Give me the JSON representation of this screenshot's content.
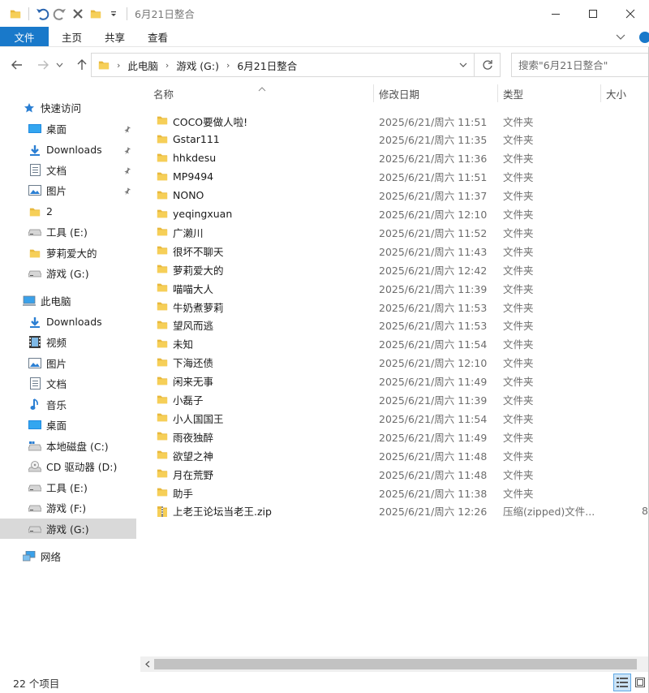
{
  "window": {
    "title": "6月21日整合",
    "minimize_icon": "minimize-icon",
    "maximize_icon": "maximize-icon",
    "close_icon": "close-icon"
  },
  "ribbon": {
    "tabs": [
      {
        "label": "文件"
      },
      {
        "label": "主页"
      },
      {
        "label": "共享"
      },
      {
        "label": "查看"
      }
    ]
  },
  "address": {
    "crumbs": [
      "此电脑",
      "游戏 (G:)",
      "6月21日整合"
    ]
  },
  "search": {
    "placeholder": "搜索\"6月21日整合\""
  },
  "columns": {
    "name": "名称",
    "date": "修改日期",
    "type": "类型",
    "size": "大小"
  },
  "navpane": {
    "quick_access": "快速访问",
    "quick_items": [
      {
        "label": "桌面",
        "icon": "desktop-icon",
        "pinned": true
      },
      {
        "label": "Downloads",
        "icon": "download-icon",
        "pinned": true
      },
      {
        "label": "文档",
        "icon": "document-icon",
        "pinned": true
      },
      {
        "label": "图片",
        "icon": "picture-icon",
        "pinned": true
      },
      {
        "label": "2",
        "icon": "folder-icon",
        "pinned": false
      },
      {
        "label": "工具 (E:)",
        "icon": "drive-icon",
        "pinned": false
      },
      {
        "label": "萝莉爱大的",
        "icon": "folder-icon",
        "pinned": false
      },
      {
        "label": "游戏 (G:)",
        "icon": "drive-icon",
        "pinned": false
      }
    ],
    "this_pc": "此电脑",
    "pc_items": [
      {
        "label": "Downloads",
        "icon": "download-icon"
      },
      {
        "label": "视频",
        "icon": "video-icon"
      },
      {
        "label": "图片",
        "icon": "picture-icon"
      },
      {
        "label": "文档",
        "icon": "document-icon"
      },
      {
        "label": "音乐",
        "icon": "music-icon"
      },
      {
        "label": "桌面",
        "icon": "desktop-icon"
      },
      {
        "label": "本地磁盘 (C:)",
        "icon": "system-drive-icon"
      },
      {
        "label": "CD 驱动器 (D:)",
        "icon": "cd-drive-icon"
      },
      {
        "label": "工具 (E:)",
        "icon": "drive-icon"
      },
      {
        "label": "游戏 (F:)",
        "icon": "drive-icon"
      },
      {
        "label": "游戏 (G:)",
        "icon": "drive-icon"
      }
    ],
    "network": "网络"
  },
  "files": [
    {
      "name": "COCO要做人啦!",
      "date": "2025/6/21/周六 11:51",
      "type": "文件夹",
      "size": "",
      "icon": "folder-icon"
    },
    {
      "name": "Gstar111",
      "date": "2025/6/21/周六 11:35",
      "type": "文件夹",
      "size": "",
      "icon": "folder-icon"
    },
    {
      "name": "hhkdesu",
      "date": "2025/6/21/周六 11:36",
      "type": "文件夹",
      "size": "",
      "icon": "folder-icon"
    },
    {
      "name": "MP9494",
      "date": "2025/6/21/周六 11:51",
      "type": "文件夹",
      "size": "",
      "icon": "folder-icon"
    },
    {
      "name": "NONO",
      "date": "2025/6/21/周六 11:37",
      "type": "文件夹",
      "size": "",
      "icon": "folder-icon"
    },
    {
      "name": "yeqingxuan",
      "date": "2025/6/21/周六 12:10",
      "type": "文件夹",
      "size": "",
      "icon": "folder-icon"
    },
    {
      "name": "广濑川",
      "date": "2025/6/21/周六 11:52",
      "type": "文件夹",
      "size": "",
      "icon": "folder-icon"
    },
    {
      "name": "很坏不聊天",
      "date": "2025/6/21/周六 11:43",
      "type": "文件夹",
      "size": "",
      "icon": "folder-icon"
    },
    {
      "name": "萝莉爱大的",
      "date": "2025/6/21/周六 12:42",
      "type": "文件夹",
      "size": "",
      "icon": "folder-icon"
    },
    {
      "name": "喵喵大人",
      "date": "2025/6/21/周六 11:39",
      "type": "文件夹",
      "size": "",
      "icon": "folder-icon"
    },
    {
      "name": "牛奶煮萝莉",
      "date": "2025/6/21/周六 11:53",
      "type": "文件夹",
      "size": "",
      "icon": "folder-icon"
    },
    {
      "name": "望风而逃",
      "date": "2025/6/21/周六 11:53",
      "type": "文件夹",
      "size": "",
      "icon": "folder-icon"
    },
    {
      "name": "未知",
      "date": "2025/6/21/周六 11:54",
      "type": "文件夹",
      "size": "",
      "icon": "folder-icon"
    },
    {
      "name": "下海还债",
      "date": "2025/6/21/周六 12:10",
      "type": "文件夹",
      "size": "",
      "icon": "folder-icon"
    },
    {
      "name": "闲来无事",
      "date": "2025/6/21/周六 11:49",
      "type": "文件夹",
      "size": "",
      "icon": "folder-icon"
    },
    {
      "name": "小磊子",
      "date": "2025/6/21/周六 11:39",
      "type": "文件夹",
      "size": "",
      "icon": "folder-icon"
    },
    {
      "name": "小人国国王",
      "date": "2025/6/21/周六 11:54",
      "type": "文件夹",
      "size": "",
      "icon": "folder-icon"
    },
    {
      "name": "雨夜独醉",
      "date": "2025/6/21/周六 11:49",
      "type": "文件夹",
      "size": "",
      "icon": "folder-icon"
    },
    {
      "name": "欲望之神",
      "date": "2025/6/21/周六 11:48",
      "type": "文件夹",
      "size": "",
      "icon": "folder-icon"
    },
    {
      "name": "月在荒野",
      "date": "2025/6/21/周六 11:48",
      "type": "文件夹",
      "size": "",
      "icon": "folder-icon"
    },
    {
      "name": "助手",
      "date": "2025/6/21/周六 11:38",
      "type": "文件夹",
      "size": "",
      "icon": "folder-icon"
    },
    {
      "name": "上老王论坛当老王.zip",
      "date": "2025/6/21/周六 12:26",
      "type": "压缩(zipped)文件...",
      "size": "8",
      "icon": "zip-folder-icon"
    }
  ],
  "status": {
    "count": "22 个项目"
  },
  "colors": {
    "accent": "#1979ca",
    "folder": "#e8b83c",
    "selected": "#d9d9d9"
  }
}
